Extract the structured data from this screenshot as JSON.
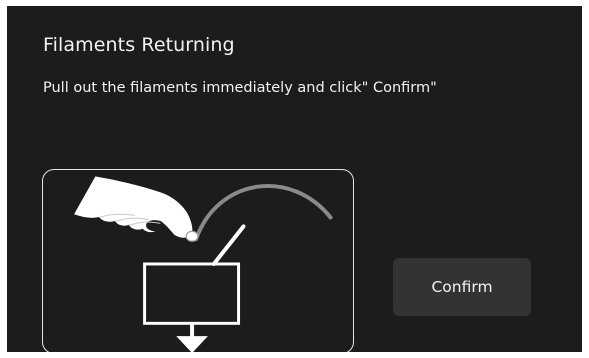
{
  "dialog": {
    "title": "Filaments Returning",
    "message": "Pull out the filaments immediately and click\" Confirm\"",
    "confirm_label": "Confirm"
  },
  "colors": {
    "background": "#1c1c1c",
    "text": "#f2f2f2",
    "button": "#333333",
    "filament_arc": "#8a8a8a"
  },
  "icons": [
    "hand-pulling-filament-icon",
    "filament-icon",
    "extruder-icon",
    "nozzle-icon"
  ]
}
